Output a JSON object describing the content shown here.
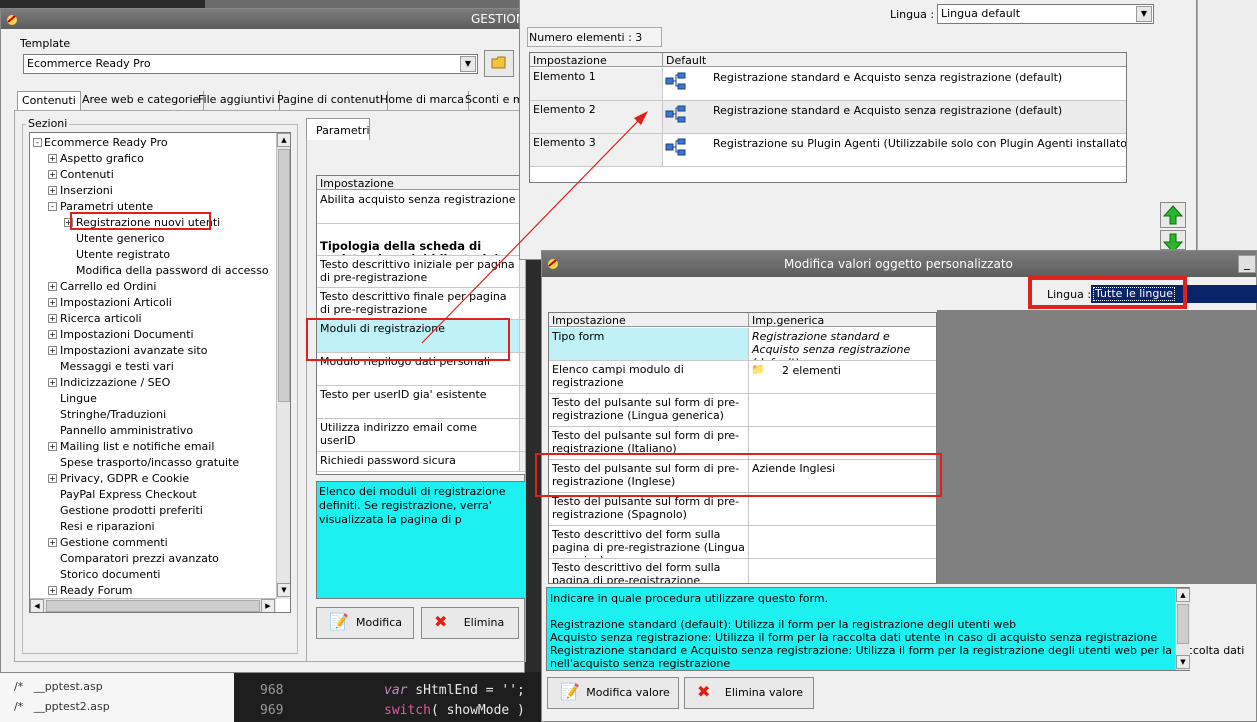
{
  "main_window": {
    "title": "GESTION",
    "template_label": "Template",
    "template_value": "Ecommerce Ready Pro",
    "tabs": [
      "Contenuti",
      "Aree web e categorie",
      "File aggiuntivi",
      "Pagine di contenuti",
      "Home di marca",
      "Sconti e ma"
    ],
    "sections_label": "Sezioni",
    "tree_root": "Ecommerce Ready Pro",
    "tree": [
      {
        "label": "Aspetto grafico",
        "level": 1,
        "exp": "+"
      },
      {
        "label": "Contenuti",
        "level": 1,
        "exp": "+"
      },
      {
        "label": "Inserzioni",
        "level": 1,
        "exp": "+"
      },
      {
        "label": "Parametri utente",
        "level": 1,
        "exp": "-"
      },
      {
        "label": "Registrazione nuovi utenti",
        "level": 2,
        "exp": "+"
      },
      {
        "label": "Utente generico",
        "level": 2,
        "exp": ""
      },
      {
        "label": "Utente registrato",
        "level": 2,
        "exp": ""
      },
      {
        "label": "Modifica della password di accesso",
        "level": 2,
        "exp": ""
      },
      {
        "label": "Carrello ed Ordini",
        "level": 1,
        "exp": "+"
      },
      {
        "label": "Impostazioni Articoli",
        "level": 1,
        "exp": "+"
      },
      {
        "label": "Ricerca articoli",
        "level": 1,
        "exp": "+"
      },
      {
        "label": "Impostazioni Documenti",
        "level": 1,
        "exp": "+"
      },
      {
        "label": "Impostazioni avanzate sito",
        "level": 1,
        "exp": "+"
      },
      {
        "label": "Messaggi e testi vari",
        "level": 1,
        "exp": ""
      },
      {
        "label": "Indicizzazione / SEO",
        "level": 1,
        "exp": "+"
      },
      {
        "label": "Lingue",
        "level": 1,
        "exp": ""
      },
      {
        "label": "Stringhe/Traduzioni",
        "level": 1,
        "exp": ""
      },
      {
        "label": "Pannello amministrativo",
        "level": 1,
        "exp": ""
      },
      {
        "label": "Mailing list e notifiche email",
        "level": 1,
        "exp": "+"
      },
      {
        "label": "Spese trasporto/incasso gratuite",
        "level": 1,
        "exp": ""
      },
      {
        "label": "Privacy, GDPR e Cookie",
        "level": 1,
        "exp": "+"
      },
      {
        "label": "PayPal Express Checkout",
        "level": 1,
        "exp": ""
      },
      {
        "label": "Gestione prodotti preferiti",
        "level": 1,
        "exp": ""
      },
      {
        "label": "Resi e riparazioni",
        "level": 1,
        "exp": ""
      },
      {
        "label": "Gestione commenti",
        "level": 1,
        "exp": "+"
      },
      {
        "label": "Comparatori prezzi avanzato",
        "level": 1,
        "exp": ""
      },
      {
        "label": "Storico documenti",
        "level": 1,
        "exp": ""
      },
      {
        "label": "Ready Forum",
        "level": 1,
        "exp": "+"
      }
    ],
    "params_tab": "Parametri",
    "params_header": "Impostazione",
    "params_rows": [
      {
        "label": "Abilita acquisto senza registrazione",
        "bold": false
      },
      {
        "label": "Tipologia della scheda di registrazione (obbligatorio)",
        "bold": true
      },
      {
        "label": "Testo descrittivo iniziale per pagina di pre-registrazione",
        "bold": false
      },
      {
        "label": "Testo descrittivo finale per pagina di pre-registrazione",
        "bold": false
      },
      {
        "label": "Moduli di registrazione",
        "bold": false
      },
      {
        "label": "Modulo riepilogo dati personali",
        "bold": false
      },
      {
        "label": "Testo per userID gia' esistente",
        "bold": false
      },
      {
        "label": "Utilizza indirizzo email come userID",
        "bold": false
      },
      {
        "label": "Richiedi password sicura",
        "bold": false
      }
    ],
    "description": "Elenco dei moduli di registrazione definiti. Se registrazione, verra' visualizzata la pagina di p",
    "btn_modifica": "Modifica",
    "btn_elimina": "Elimina"
  },
  "mid_window": {
    "lingua_label": "Lingua :",
    "lingua_value": "Lingua default",
    "count": "Numero elementi : 3",
    "col1": "Impostazione",
    "col2": "Default",
    "rows": [
      {
        "name": "Elemento 1",
        "value": "Registrazione standard e Acquisto senza registrazione (default)"
      },
      {
        "name": "Elemento 2",
        "value": "Registrazione standard e Acquisto senza registrazione (default)"
      },
      {
        "name": "Elemento 3",
        "value": "Registrazione su Plugin Agenti (Utilizzabile solo con Plugin Agenti installato)"
      }
    ]
  },
  "dialog": {
    "title": "Modifica valori oggetto personalizzato",
    "lingua_label": "Lingua :",
    "lingua_value": "Tutte le lingue",
    "col1": "Impostazione",
    "col2": "Imp.generica",
    "rows": [
      {
        "label": "Tipo form",
        "value": "Registrazione standard e Acquisto senza registrazione (default)"
      },
      {
        "label": "Elenco campi modulo di registrazione",
        "value": "2 elementi"
      },
      {
        "label": "Testo del pulsante sul form di pre-registrazione (Lingua generica)",
        "value": ""
      },
      {
        "label": "Testo del pulsante sul form di pre-registrazione (Italiano)",
        "value": ""
      },
      {
        "label": "Testo del pulsante sul form di pre-registrazione (Inglese)",
        "value": "Aziende Inglesi"
      },
      {
        "label": "Testo del pulsante sul form di pre-registrazione (Spagnolo)",
        "value": ""
      },
      {
        "label": "Testo descrittivo del form sulla pagina di pre-registrazione (Lingua generica)",
        "value": ""
      },
      {
        "label": "Testo descrittivo del form sulla pagina di pre-registrazione (Italiano)",
        "value": ""
      }
    ],
    "info_1": "Indicare in quale procedura utilizzare questo form.",
    "info_2": "Registrazione standard (default): Utilizza il form per la registrazione degli utenti web",
    "info_3": "Acquisto senza registrazione: Utilizza il form per la raccolta dati utente in caso di acquisto senza registrazione",
    "info_4": "Registrazione standard e Acquisto senza registrazione: Utilizza il form per la registrazione degli utenti web per la raccolta dati",
    "info_5": "nell'acquisto senza registrazione",
    "btn_modifica": "Modifica valore",
    "btn_elimina": "Elimina valore"
  },
  "editor": {
    "files": [
      "__pptest.asp",
      "__pptest2.asp"
    ],
    "line_numbers": [
      "968",
      "969"
    ],
    "code_1a": "var",
    "code_1b": " sHtmlEnd = '';",
    "code_2a": "switch",
    "code_2b": "( showMode )"
  },
  "colors": {
    "highlight": "#e0201c",
    "cyan": "#1cf0f0",
    "light_cyan": "#c6f2fa",
    "selection": "#0a246a"
  }
}
